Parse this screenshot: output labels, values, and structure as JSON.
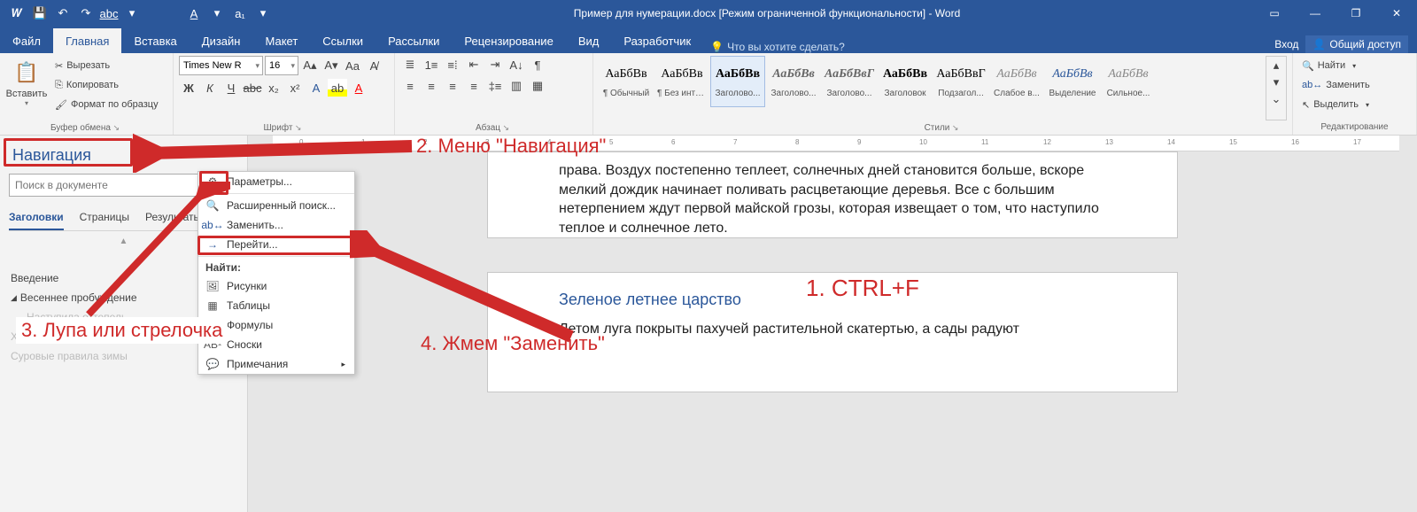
{
  "title": "Пример для нумерации.docx [Режим ограниченной функциональности] - Word",
  "tabs": {
    "file": "Файл",
    "home": "Главная",
    "insert": "Вставка",
    "design": "Дизайн",
    "layout": "Макет",
    "references": "Ссылки",
    "mailings": "Рассылки",
    "review": "Рецензирование",
    "view": "Вид",
    "developer": "Разработчик"
  },
  "tellme": "Что вы хотите сделать?",
  "signin": "Вход",
  "share": "Общий доступ",
  "ribbon": {
    "clipboard": {
      "label": "Буфер обмена",
      "paste": "Вставить",
      "cut": "Вырезать",
      "copy": "Копировать",
      "fmt": "Формат по образцу"
    },
    "font": {
      "label": "Шрифт",
      "name": "Times New R",
      "size": "16"
    },
    "para": {
      "label": "Абзац"
    },
    "styles": {
      "label": "Стили",
      "sample": "АаБбВв",
      "sampleG": "АаБбВвГ",
      "list": [
        "Обычный",
        "Без инте...",
        "Заголово...",
        "Заголово...",
        "Заголово...",
        "Заголовок",
        "Подзагол...",
        "Слабое в...",
        "Выделение",
        "Сильное..."
      ],
      "selectedIndex": 2
    },
    "editing": {
      "label": "Редактирование",
      "find": "Найти",
      "replace": "Заменить",
      "select": "Выделить"
    }
  },
  "nav": {
    "title": "Навигация",
    "placeholder": "Поиск в документе",
    "tabs": [
      "Заголовки",
      "Страницы",
      "Результаты"
    ],
    "items": [
      "Введение",
      "Весеннее пробуждение",
      "Наступила оттепель",
      "Хмурая осень",
      "Суровые правила зимы"
    ]
  },
  "menu": {
    "options": "Параметры...",
    "advfind": "Расширенный поиск...",
    "replace": "Заменить...",
    "goto": "Перейти...",
    "findhead": "Найти:",
    "pics": "Рисунки",
    "tables": "Таблицы",
    "formulas": "Формулы",
    "footnotes": "Сноски",
    "comments": "Примечания"
  },
  "doc": {
    "p1": "права. Воздух постепенно теплеет, солнечных дней становится больше, вскоре мелкий дождик начинает поливать расцветающие деревья. Все с большим нетерпением ждут первой майской грозы, которая извещает о том, что наступило теплое и солнечное лето.",
    "h2": "Зеленое летнее царство",
    "p2": "Летом луга покрыты пахучей растительной скатертью, а сады радуют"
  },
  "ann": {
    "a1": "1. CTRL+F",
    "a2": "2. Меню \"Навигация\"",
    "a3": "3. Лупа или стрелочка",
    "a4": "4. Жмем \"Заменить\""
  }
}
